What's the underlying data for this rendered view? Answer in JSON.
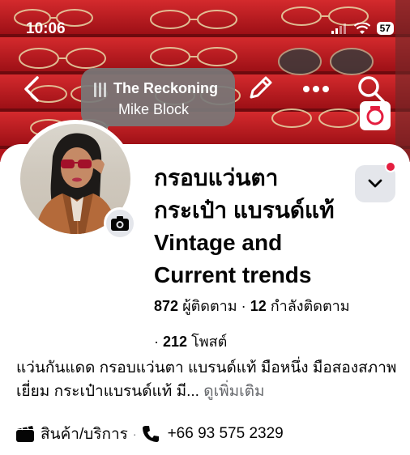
{
  "status_bar": {
    "time": "10:06",
    "battery": "57"
  },
  "music": {
    "title": "The Reckoning",
    "artist": "Mike Block"
  },
  "profile": {
    "name_line1": "กรอบแว่นตา",
    "name_line2": "กระเป๋า แบรนด์แท้",
    "name_line3": "Vintage and",
    "name_line4": "Current trends",
    "followers_count": "872",
    "followers_label": "ผู้ติดตาม",
    "following_count": "12",
    "following_label": "กำลังติดตาม",
    "posts_count": "212",
    "posts_label": "โพสต์",
    "separator": "·"
  },
  "bio": {
    "text": "แว่นกันแดด กรอบแว่นตา แบรนด์แท้ มือหนึ่ง มือสองสภาพเยี่ยม กระเป๋าแบรนด์แท้ มี...",
    "see_more": "ดูเพิ่มเติม"
  },
  "contact": {
    "category": "สินค้า/บริการ",
    "phone": "+66 93 575 2329"
  },
  "colors": {
    "cover_red": "#b3141b",
    "notification_red": "#e41e3f",
    "button_gray": "#e4e6eb",
    "secondary_text": "#65676b"
  }
}
